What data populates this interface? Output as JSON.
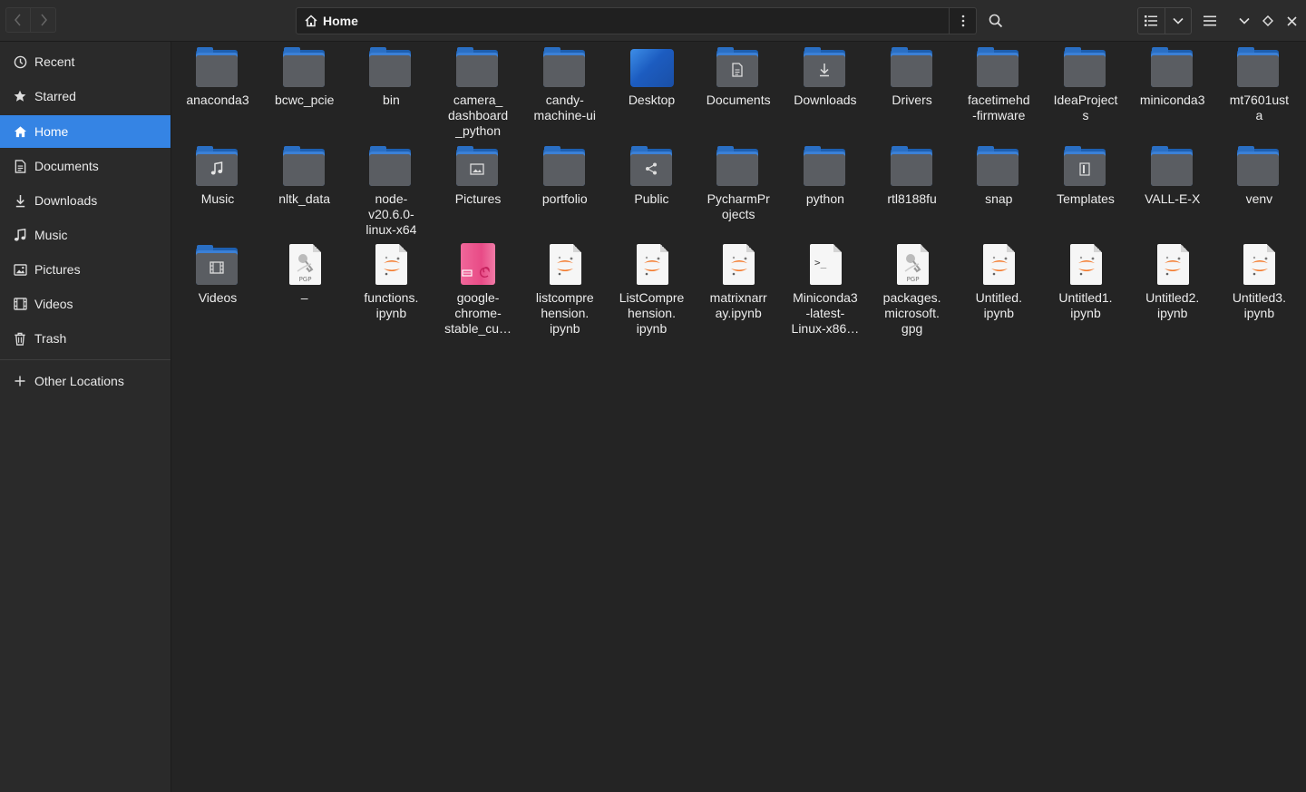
{
  "header": {
    "location": "Home"
  },
  "sidebar": {
    "items": [
      {
        "label": "Recent",
        "icon": "clock-icon"
      },
      {
        "label": "Starred",
        "icon": "star-icon"
      },
      {
        "label": "Home",
        "icon": "home-icon",
        "active": true
      },
      {
        "label": "Documents",
        "icon": "document-icon"
      },
      {
        "label": "Downloads",
        "icon": "download-icon"
      },
      {
        "label": "Music",
        "icon": "music-icon"
      },
      {
        "label": "Pictures",
        "icon": "picture-icon"
      },
      {
        "label": "Videos",
        "icon": "video-icon"
      },
      {
        "label": "Trash",
        "icon": "trash-icon"
      }
    ],
    "other_locations": "Other Locations"
  },
  "files": [
    {
      "name": "anaconda3",
      "kind": "folder"
    },
    {
      "name": "bcwc_pcie",
      "kind": "folder"
    },
    {
      "name": "bin",
      "kind": "folder"
    },
    {
      "name": "camera_\ndashboard\n_python",
      "kind": "folder"
    },
    {
      "name": "candy-\nmachine-ui",
      "kind": "folder"
    },
    {
      "name": "Desktop",
      "kind": "desktop"
    },
    {
      "name": "Documents",
      "kind": "folder",
      "emblem": "document"
    },
    {
      "name": "Downloads",
      "kind": "folder",
      "emblem": "download"
    },
    {
      "name": "Drivers",
      "kind": "folder"
    },
    {
      "name": "facetimehd\n-firmware",
      "kind": "folder"
    },
    {
      "name": "IdeaProject\ns",
      "kind": "folder"
    },
    {
      "name": "miniconda3",
      "kind": "folder"
    },
    {
      "name": "mt7601ust\na",
      "kind": "folder"
    },
    {
      "name": "Music",
      "kind": "folder",
      "emblem": "music"
    },
    {
      "name": "nltk_data",
      "kind": "folder"
    },
    {
      "name": "node-\nv20.6.0-\nlinux-x64",
      "kind": "folder"
    },
    {
      "name": "Pictures",
      "kind": "folder",
      "emblem": "picture"
    },
    {
      "name": "portfolio",
      "kind": "folder"
    },
    {
      "name": "Public",
      "kind": "folder",
      "emblem": "share"
    },
    {
      "name": "PycharmPr\nojects",
      "kind": "folder"
    },
    {
      "name": "python",
      "kind": "folder"
    },
    {
      "name": "rtl8188fu",
      "kind": "folder"
    },
    {
      "name": "snap",
      "kind": "folder"
    },
    {
      "name": "Templates",
      "kind": "folder",
      "emblem": "template"
    },
    {
      "name": "VALL-E-X",
      "kind": "folder"
    },
    {
      "name": "venv",
      "kind": "folder"
    },
    {
      "name": "Videos",
      "kind": "folder",
      "emblem": "video"
    },
    {
      "name": "–",
      "kind": "pgp"
    },
    {
      "name": "functions.\nipynb",
      "kind": "jupyter"
    },
    {
      "name": "google-\nchrome-\nstable_cu…",
      "kind": "deb"
    },
    {
      "name": "listcompre\nhension.\nipynb",
      "kind": "jupyter"
    },
    {
      "name": "ListCompre\nhension.\nipynb",
      "kind": "jupyter"
    },
    {
      "name": "matrixnarr\nay.ipynb",
      "kind": "jupyter"
    },
    {
      "name": "Miniconda3\n-latest-\nLinux-x86…",
      "kind": "script"
    },
    {
      "name": "packages.\nmicrosoft.\ngpg",
      "kind": "pgp"
    },
    {
      "name": "Untitled.\nipynb",
      "kind": "jupyter"
    },
    {
      "name": "Untitled1.\nipynb",
      "kind": "jupyter"
    },
    {
      "name": "Untitled2.\nipynb",
      "kind": "jupyter"
    },
    {
      "name": "Untitled3.\nipynb",
      "kind": "jupyter"
    }
  ],
  "colors": {
    "accent": "#3584e4",
    "background": "#242424",
    "sidebar": "#2a2a2a",
    "folder_blue": "#2a6fc4",
    "jupyter_orange": "#f37626"
  }
}
